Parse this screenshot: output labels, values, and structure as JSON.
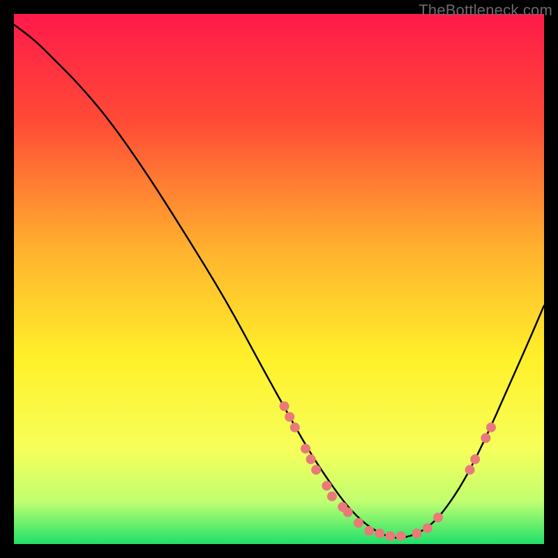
{
  "watermark": "TheBottleneck.com",
  "chart_data": {
    "type": "line",
    "title": "",
    "xlabel": "",
    "ylabel": "",
    "xlim": [
      0,
      100
    ],
    "ylim": [
      0,
      100
    ],
    "gradient_stops": [
      {
        "offset": 0,
        "color": "#ff1a4b"
      },
      {
        "offset": 20,
        "color": "#ff4a36"
      },
      {
        "offset": 45,
        "color": "#ffb42e"
      },
      {
        "offset": 65,
        "color": "#fff02a"
      },
      {
        "offset": 82,
        "color": "#f7ff5a"
      },
      {
        "offset": 92,
        "color": "#c0ff70"
      },
      {
        "offset": 100,
        "color": "#1fe06a"
      }
    ],
    "series": [
      {
        "name": "curve",
        "x": [
          0,
          4,
          8,
          12,
          18,
          25,
          32,
          40,
          47,
          52,
          56,
          60,
          63,
          66,
          69,
          72,
          75,
          78,
          81,
          85,
          89,
          93,
          97,
          100
        ],
        "y": [
          98,
          95,
          91,
          87,
          80,
          70,
          59,
          46,
          33,
          24,
          17,
          11,
          7,
          4,
          2,
          1,
          1.5,
          3,
          6,
          12,
          20,
          29,
          38,
          45
        ]
      }
    ],
    "markers": [
      {
        "x": 51,
        "y": 26
      },
      {
        "x": 52,
        "y": 24
      },
      {
        "x": 53,
        "y": 22
      },
      {
        "x": 55,
        "y": 18
      },
      {
        "x": 56,
        "y": 16
      },
      {
        "x": 57,
        "y": 14
      },
      {
        "x": 59,
        "y": 11
      },
      {
        "x": 60,
        "y": 9
      },
      {
        "x": 62,
        "y": 7
      },
      {
        "x": 63,
        "y": 6
      },
      {
        "x": 65,
        "y": 4
      },
      {
        "x": 67,
        "y": 2.5
      },
      {
        "x": 69,
        "y": 2
      },
      {
        "x": 71,
        "y": 1.5
      },
      {
        "x": 73,
        "y": 1.5
      },
      {
        "x": 76,
        "y": 2
      },
      {
        "x": 78,
        "y": 3
      },
      {
        "x": 80,
        "y": 5
      },
      {
        "x": 86,
        "y": 14
      },
      {
        "x": 87,
        "y": 16
      },
      {
        "x": 89,
        "y": 20
      },
      {
        "x": 90,
        "y": 22
      }
    ],
    "marker_style": {
      "r": 7,
      "fill": "#e97a7a",
      "stroke": "none"
    }
  }
}
